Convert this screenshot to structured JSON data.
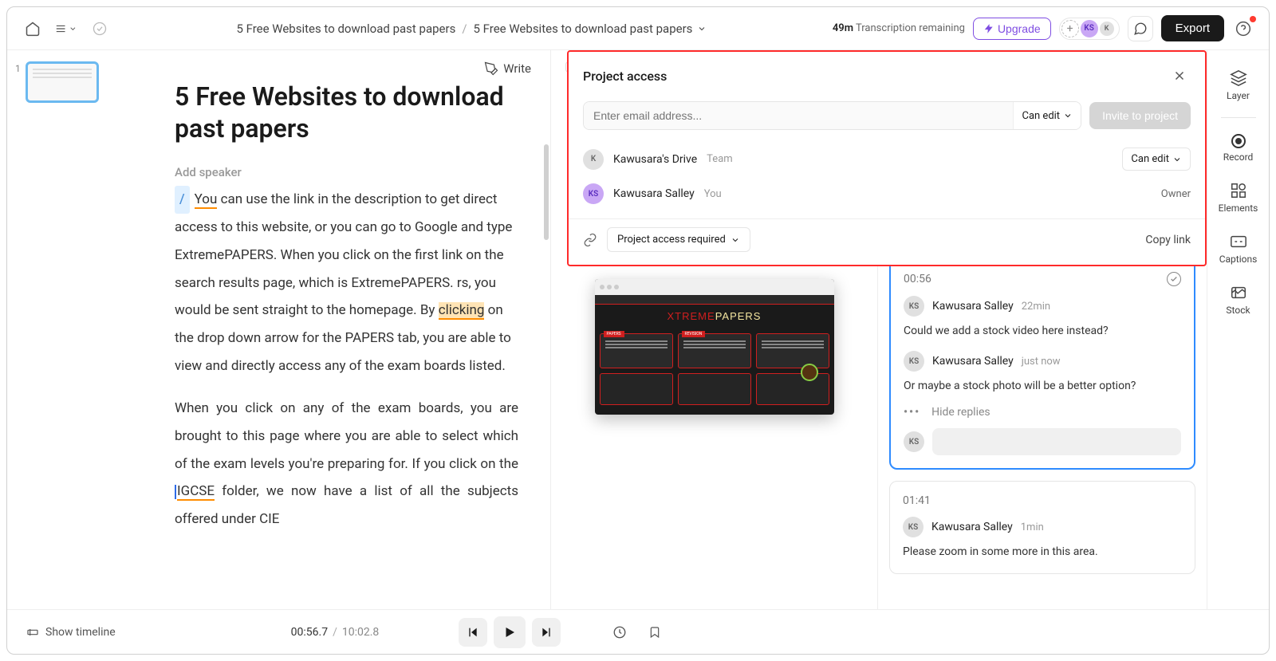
{
  "topbar": {
    "breadcrumb_parent": "5 Free Websites to download past papers",
    "breadcrumb_current": "5 Free Websites to download past papers",
    "transcription_minutes": "49m",
    "transcription_label": "Transcription remaining",
    "upgrade_label": "Upgrade",
    "user_initials_1": "KS",
    "user_initials_2": "K",
    "export_label": "Export"
  },
  "thumbs": {
    "first_index": "1"
  },
  "editor": {
    "write_label": "Write",
    "title": "5 Free Websites to download past papers",
    "add_speaker": "Add speaker",
    "p1_pre": "You",
    "p1_rest": " can use the link in the description to get direct access to this website, or you can go to Google and type ExtremePAPERS. When you click on the first link on the search results page, which is ExtremePAPERS. rs, you would be sent straight to the homepage. By ",
    "p1_hl": "clicking",
    "p1_after": " on the drop down arrow for the PAPERS tab, you are able to view and directly access any of the exam boards listed.",
    "p2_pre": "When you click on any of the exam boards, you are brought to this page where you are able to select which of the exam levels you're preparing for. If you click on the ",
    "p2_hl": "IGCSE",
    "p2_after": " folder, we now have a list of all the subjects offered under CIE"
  },
  "preview": {
    "logo_x": "XTREME",
    "logo_p": "PAPERS"
  },
  "project_access": {
    "title": "Project access",
    "email_placeholder": "Enter email address...",
    "perm_selected": "Can edit",
    "invite_label": "Invite to project",
    "members": [
      {
        "avatar": "K",
        "name": "Kawusara's Drive",
        "meta": "Team",
        "role": "Can edit"
      },
      {
        "avatar": "KS",
        "name": "Kawusara Salley",
        "meta": "You",
        "role": "Owner"
      }
    ],
    "access_required": "Project access required",
    "copy_link": "Copy link"
  },
  "comments": [
    {
      "timestamp": "00:56",
      "entries": [
        {
          "avatar": "KS",
          "author": "Kawusara Salley",
          "time": "22min",
          "text": "Could we add a stock video here instead?"
        },
        {
          "avatar": "KS",
          "author": "Kawusara Salley",
          "time": "just now",
          "text": "Or maybe a stock photo will be a better option?"
        }
      ],
      "hide_replies": "Hide replies",
      "reply_avatar": "KS"
    },
    {
      "timestamp": "01:41",
      "entries": [
        {
          "avatar": "KS",
          "author": "Kawusara Salley",
          "time": "1min",
          "text": "Please zoom in some more in this area."
        }
      ]
    }
  ],
  "tools": {
    "layer": "Layer",
    "record": "Record",
    "elements": "Elements",
    "captions": "Captions",
    "stock": "Stock"
  },
  "bottombar": {
    "show_timeline": "Show timeline",
    "current_time": "00:56.7",
    "total_time": "10:02.8"
  }
}
